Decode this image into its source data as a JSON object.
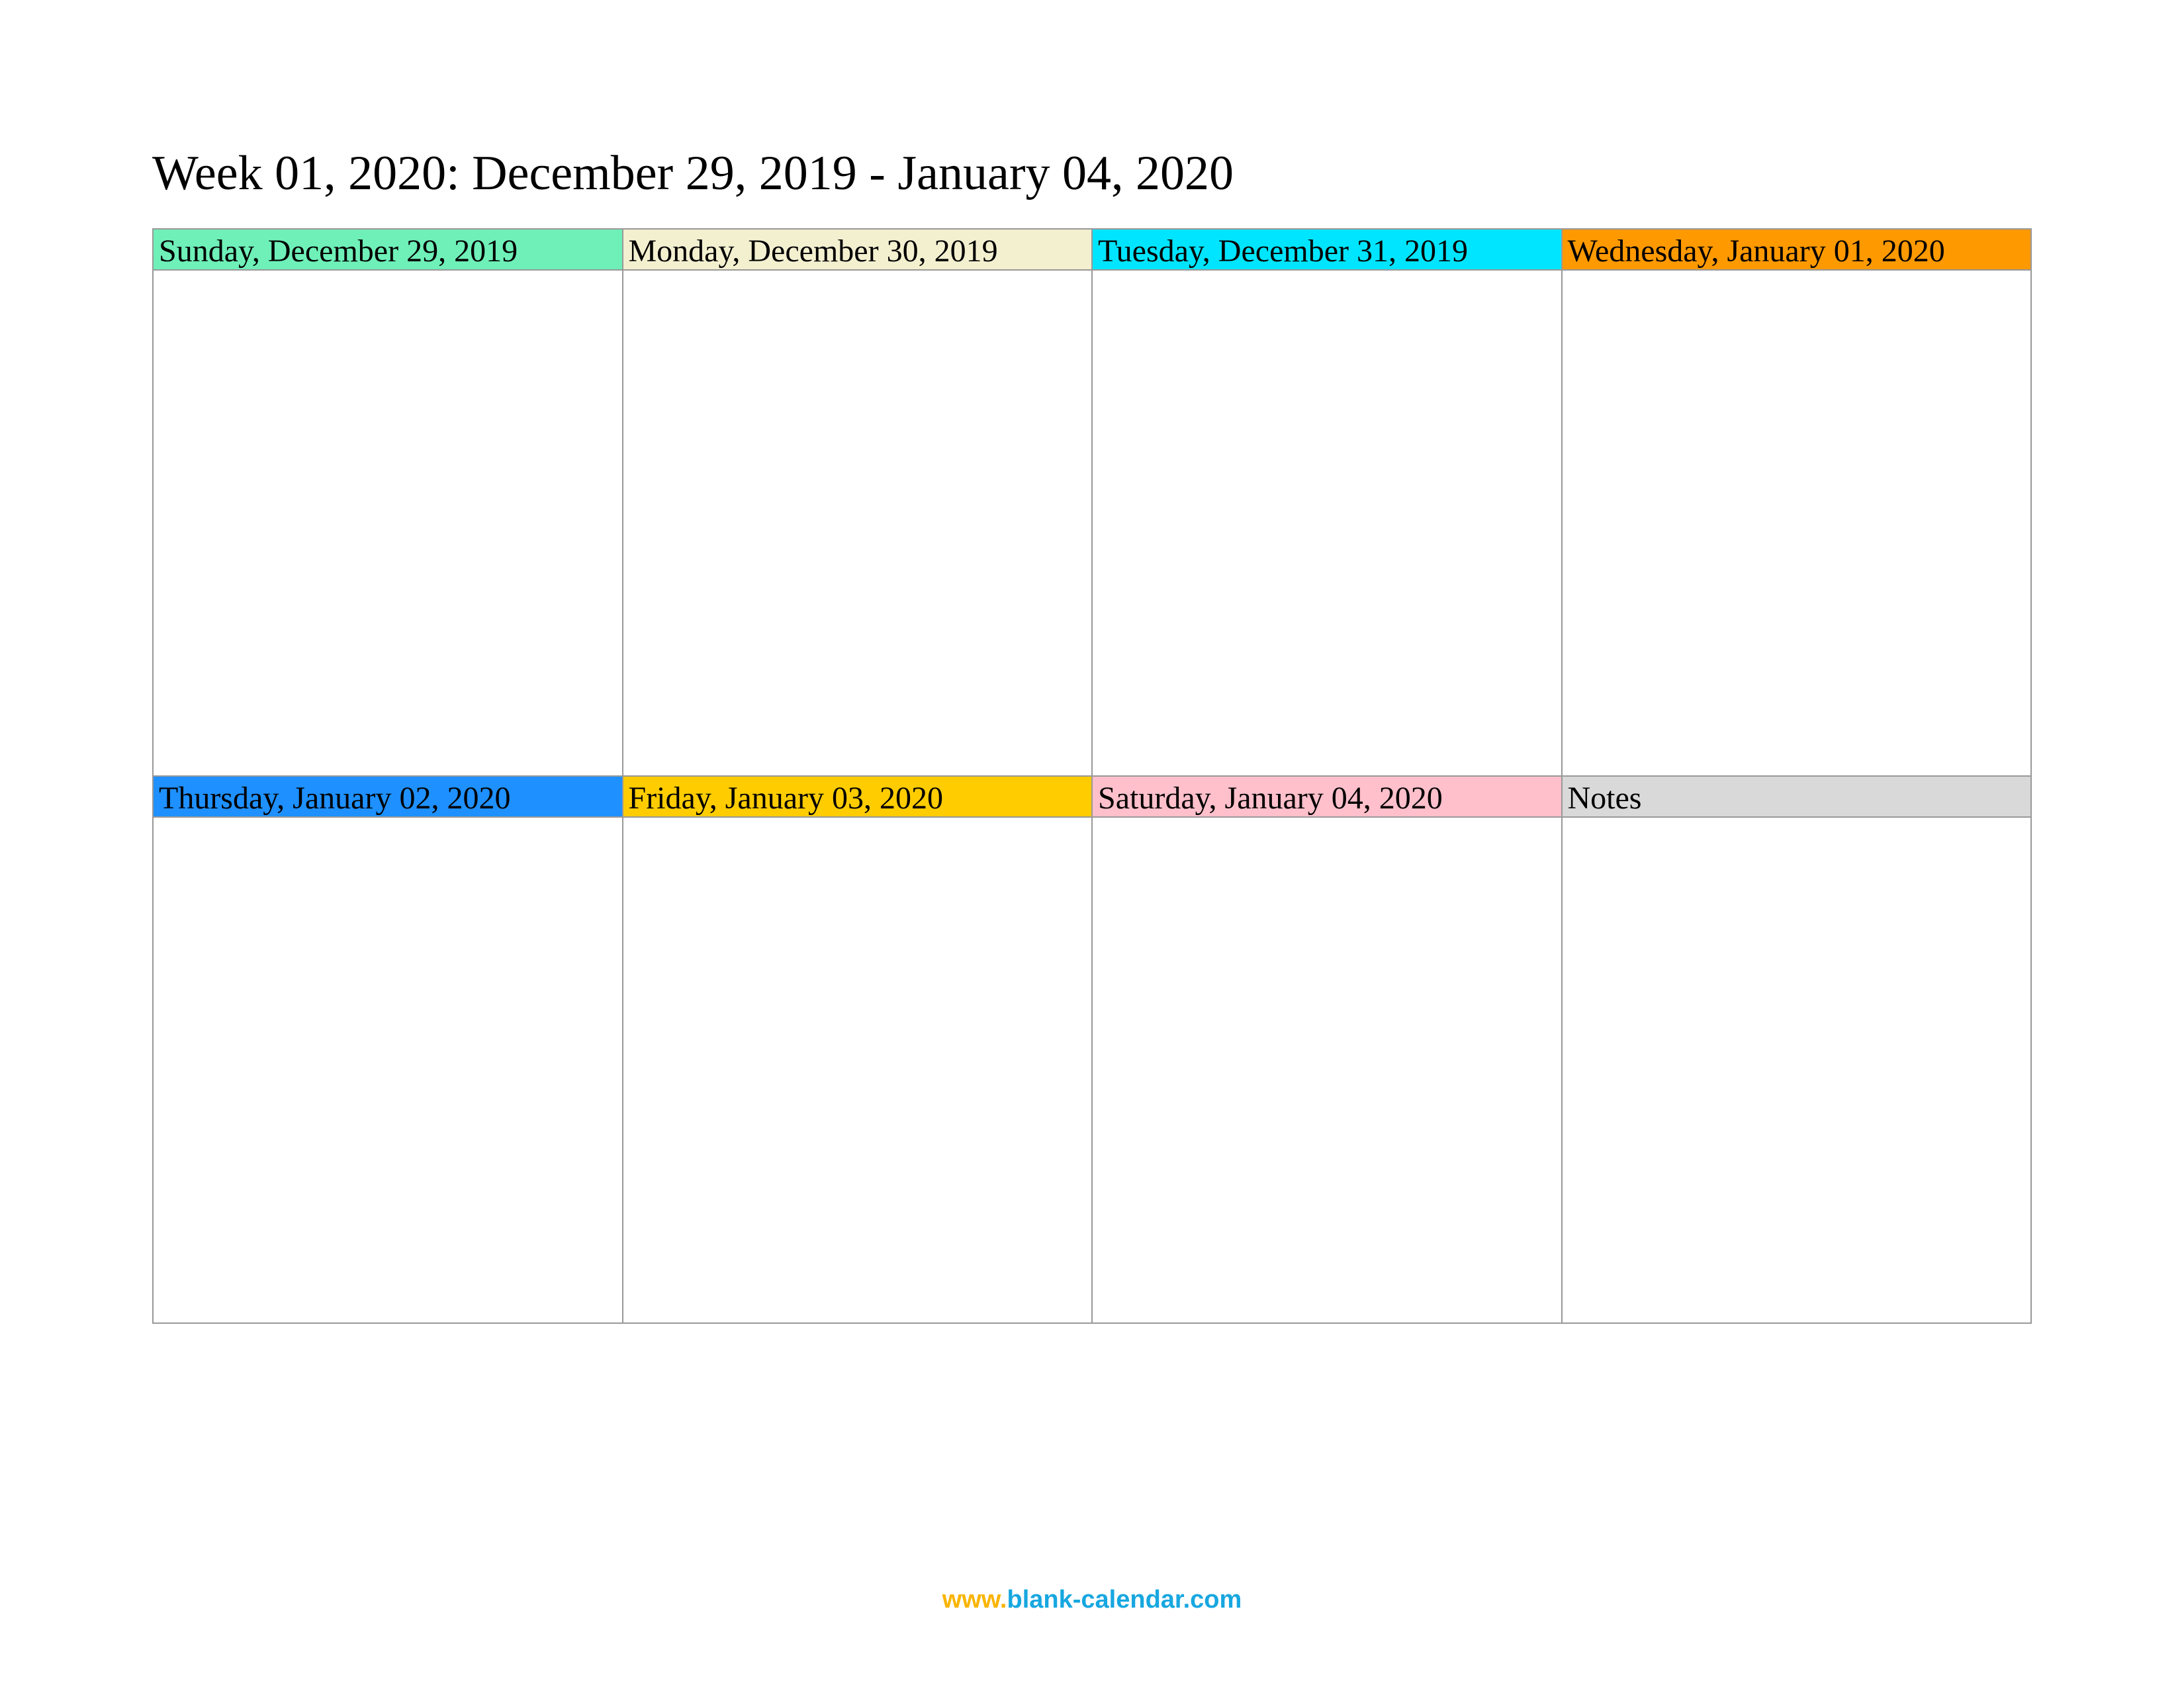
{
  "title": "Week 01, 2020: December 29, 2019 - January 04, 2020",
  "cells": [
    {
      "label": "Sunday, December 29, 2019",
      "color": "#6ef0b8"
    },
    {
      "label": "Monday, December 30, 2019",
      "color": "#f3f0d0"
    },
    {
      "label": "Tuesday, December 31, 2019",
      "color": "#00e5ff"
    },
    {
      "label": "Wednesday, January 01, 2020",
      "color": "#ff9900"
    },
    {
      "label": "Thursday, January 02, 2020",
      "color": "#1e90ff"
    },
    {
      "label": "Friday, January 03, 2020",
      "color": "#ffcc00"
    },
    {
      "label": "Saturday, January 04, 2020",
      "color": "#ffc0cb"
    },
    {
      "label": "Notes",
      "color": "#d9d9d9"
    }
  ],
  "footer": {
    "www": "www.",
    "domain": "blank-calendar.com"
  }
}
